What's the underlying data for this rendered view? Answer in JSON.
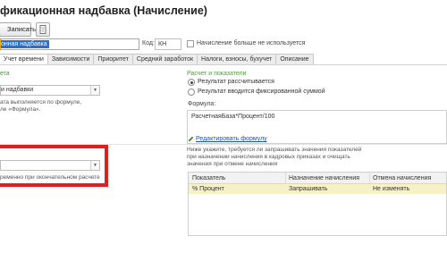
{
  "window": {
    "title": "фикационная надбавка (Начисление)"
  },
  "toolbar": {
    "save_label": "Записать",
    "extra_icon": "document-icon"
  },
  "name_field": {
    "value": "онная надбавка"
  },
  "code": {
    "label": "Код:",
    "value": "КН"
  },
  "unused_checkbox": {
    "label": "Начисление больше не используется",
    "checked": false
  },
  "tabs": [
    {
      "label": "Учет времени"
    },
    {
      "label": "Зависимости"
    },
    {
      "label": "Приоритет"
    },
    {
      "label": "Средний заработок"
    },
    {
      "label": "Налоги, взносы, бухучет"
    },
    {
      "label": "Описание"
    }
  ],
  "left": {
    "section_fragment": "ета",
    "purpose_value": "и надбавки",
    "desc_line1": "ата выполняется по формуле,",
    "desc_line2": "ле «Формула».",
    "combo_value": "",
    "note": "ременно при окончательном расчете"
  },
  "right": {
    "section_title": "Расчет и показатели",
    "radio_calculated": "Результат рассчитывается",
    "radio_fixed": "Результат вводится фиксированной суммой",
    "formula_label": "Формула:",
    "formula_value": "РасчетнаяБаза*Процент/100",
    "edit_formula_link": "Редактировать формулу",
    "hint_line1": "Ниже укажите, требуется ли запрашивать значения показателей",
    "hint_line2": "при назначении начисления в кадровых приказах и очищать",
    "hint_line3": "значения при отмене начисления"
  },
  "indicators_table": {
    "headers": [
      "Показатель",
      "Назначение начисления",
      "Отмена начисления"
    ],
    "rows": [
      [
        "% Процент",
        "Запрашивать",
        "Не изменять"
      ]
    ]
  },
  "highlight_color": "#e02020"
}
